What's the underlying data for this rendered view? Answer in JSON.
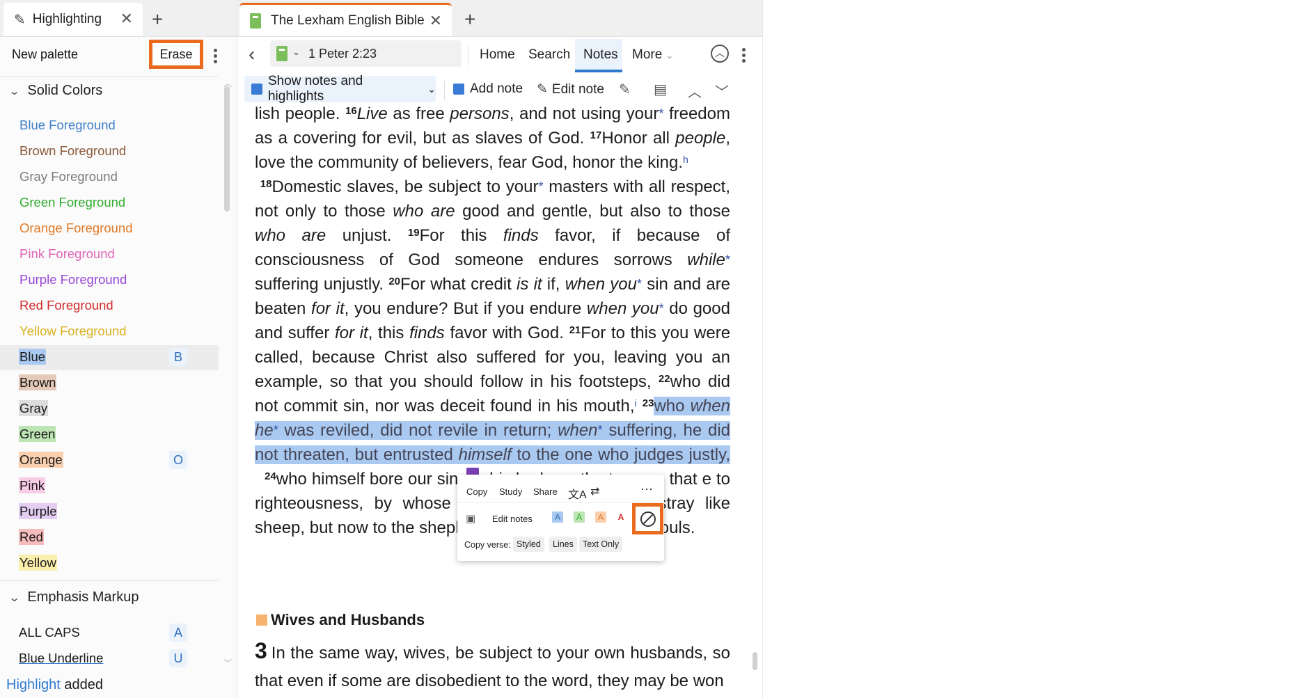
{
  "left_panel": {
    "tab_title": "Highlighting",
    "palette_name": "New palette",
    "erase_label": "Erase",
    "section_solid": "Solid Colors",
    "section_emphasis": "Emphasis Markup",
    "foreground_items": [
      {
        "label": "Blue Foreground",
        "color": "#3f7fc9"
      },
      {
        "label": "Brown Foreground",
        "color": "#8a5a3b"
      },
      {
        "label": "Gray Foreground",
        "color": "#7c7c7c"
      },
      {
        "label": "Green Foreground",
        "color": "#2fad2f"
      },
      {
        "label": "Orange Foreground",
        "color": "#e07a28"
      },
      {
        "label": "Pink Foreground",
        "color": "#e264b7"
      },
      {
        "label": "Purple Foreground",
        "color": "#9a46d8"
      },
      {
        "label": "Red Foreground",
        "color": "#d42a2a"
      },
      {
        "label": "Yellow Foreground",
        "color": "#d9b21f"
      }
    ],
    "highlight_items": [
      {
        "label": "Blue",
        "bg": "#a9c9f1",
        "shortcut": "B"
      },
      {
        "label": "Brown",
        "bg": "#e4c9b8",
        "shortcut": ""
      },
      {
        "label": "Gray",
        "bg": "#dddddd",
        "shortcut": ""
      },
      {
        "label": "Green",
        "bg": "#bde5b4",
        "shortcut": ""
      },
      {
        "label": "Orange",
        "bg": "#f9cfae",
        "shortcut": "O"
      },
      {
        "label": "Pink",
        "bg": "#f8cce7",
        "shortcut": ""
      },
      {
        "label": "Purple",
        "bg": "#e4cff3",
        "shortcut": ""
      },
      {
        "label": "Red",
        "bg": "#f6bcbc",
        "shortcut": ""
      },
      {
        "label": "Yellow",
        "bg": "#fbefad",
        "shortcut": ""
      }
    ],
    "emphasis_items": [
      {
        "label": "ALL CAPS",
        "shortcut": "A"
      },
      {
        "label": "Blue Underline",
        "shortcut": "U"
      }
    ],
    "status": {
      "link": "Highlight",
      "text": "added"
    }
  },
  "main_panel": {
    "tab_title": "The Lexham English Bible",
    "reference": "1 Peter 2:23",
    "nav": {
      "home": "Home",
      "search": "Search",
      "notes": "Notes",
      "more": "More"
    },
    "toolbar": {
      "show_notes": "Show notes and highlights",
      "add_note": "Add note",
      "edit_note": "Edit note"
    },
    "section_heading": "Wives and Husbands",
    "chapter_number": "3",
    "chapter_text": "In the same way, wives, be subject to your own husbands, so that even if some are disobedient to the word, they may be won"
  },
  "bible": {
    "l1a": "lish people.",
    "v16": "16",
    "l1b": "Live",
    "l1c": "as free",
    "l1d": "persons",
    "l1e": ", and not using your",
    "l1f": "freedom as a covering for evil, but as slaves of God.",
    "v17": "17",
    "l2a": "Honor all",
    "l2b": "people",
    "l2c": ", love the community of believers, fear God, honor the king.",
    "fn_h": "h",
    "v18": "18",
    "p2a": "Domestic slaves, be subject to your",
    "p2b": "masters with all respect, not only to those",
    "p2c": "who are",
    "p2d": "good and gentle, but also to those",
    "p2e": "who are",
    "p2f": "unjust.",
    "v19": "19",
    "p2g": "For this",
    "p2h": "finds",
    "p2i": "favor, if because of consciousness of God someone endures sorrows",
    "p2j": "while",
    "p2k": "suffering unjustly.",
    "v20": "20",
    "p2l": "For what credit",
    "p2m": "is it",
    "p2n": "if,",
    "p2o": "when you",
    "p2p": "sin and are beaten",
    "p2q": "for it",
    "p2r": ", you endure? But if you endure",
    "p2s": "when you",
    "p2t": "do good and suffer",
    "p2u": "for it",
    "p2v": ", this",
    "p2w": "finds",
    "p2x": "favor with God.",
    "v21": "21",
    "p2y": "For to this you were called, because Christ also suffered for you, leaving you an example, so that you should follow in his footsteps,",
    "v22": "22",
    "p2z": "who did not commit sin, nor was deceit found in his mouth,",
    "fn_i": "i",
    "v23": "23",
    "h1": "who",
    "h2": "when he",
    "h3": "was reviled, did not revile in return;",
    "h4": "when",
    "h5": "suffering, he did not threaten, but entrusted",
    "h6": "himself",
    "h7": "to the one who judges justly,",
    "v24": "24",
    "p3a": "who himself bore our sins in his body on the tree, so that",
    "p3b": "e to righteousness, by whose woun",
    "p3c": "you were going astray like sheep, but",
    "p3d": "now to the shepherd and guardian of your souls."
  },
  "popup": {
    "copy": "Copy",
    "study": "Study",
    "share": "Share",
    "edit_notes": "Edit notes",
    "copy_verse": "Copy verse:",
    "styled": "Styled",
    "lines": "Lines",
    "text_only": "Text Only",
    "swatch_a": "A"
  },
  "colors": {
    "accent_orange": "#ea6b1d",
    "accent_blue": "#2f7ad0"
  }
}
